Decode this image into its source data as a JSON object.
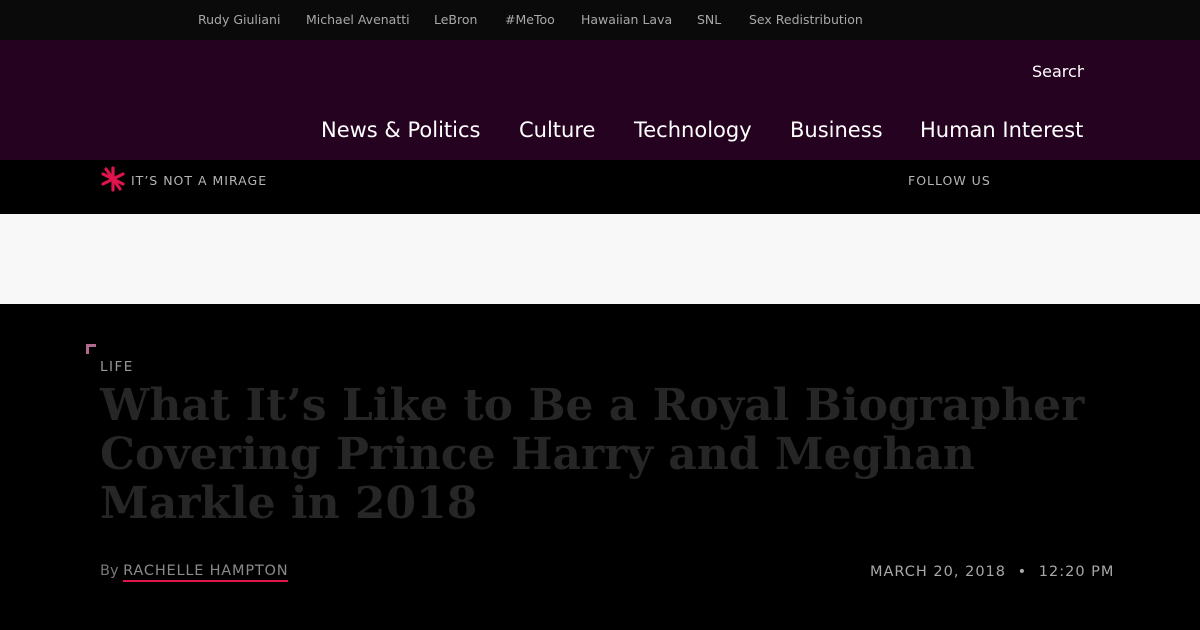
{
  "trending": [
    "Rudy Giuliani",
    "Michael Avenatti",
    "LeBron",
    "#MeToo",
    "Hawaiian Lava",
    "SNL",
    "Sex Redistribution"
  ],
  "search": {
    "label": "Search"
  },
  "nav": [
    "News & Politics",
    "Culture",
    "Technology",
    "Business",
    "Human Interest"
  ],
  "subbar": {
    "tagline": "IT’S NOT A MIRAGE",
    "follow": "FOLLOW US"
  },
  "article": {
    "category": "LIFE",
    "headline": "What It’s Like to Be a Royal Biographer Covering Prince Harry and Meghan Markle in 2018",
    "by": "By",
    "author": "RACHELLE HAMPTON",
    "date": "MARCH 20, 2018",
    "separator": "•",
    "time": "12:20 PM"
  },
  "colors": {
    "header_bg": "#250320",
    "accent": "#e0144c",
    "logo": "#e0144c",
    "corner_accent": "#b06a8f"
  },
  "icons": {
    "logo": "star-burst-logo-icon"
  }
}
